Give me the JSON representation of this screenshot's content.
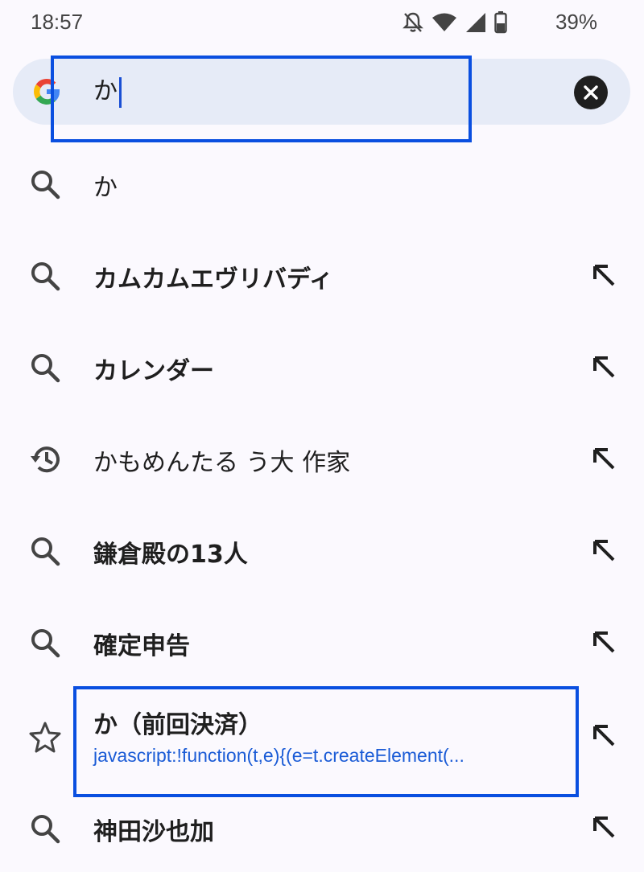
{
  "status_bar": {
    "time": "18:57",
    "battery_percent": "39%",
    "icons": [
      "bell-off-icon",
      "wifi-icon",
      "cell-signal-icon",
      "battery-icon"
    ]
  },
  "search": {
    "query": "か",
    "icons": [
      "google-logo-icon",
      "clear-icon"
    ]
  },
  "suggestions": [
    {
      "text": "か",
      "icon": "search-icon",
      "bold": false
    },
    {
      "text": "カムカムエヴリバディ",
      "icon": "search-icon",
      "bold": true
    },
    {
      "text": "カレンダー",
      "icon": "search-icon",
      "bold": true
    },
    {
      "text": "かもめんたる う大 作家",
      "icon": "history-icon",
      "bold": false
    },
    {
      "text": "鎌倉殿の13人",
      "icon": "search-icon",
      "bold": true
    },
    {
      "text": "確定申告",
      "icon": "search-icon",
      "bold": true
    },
    {
      "text": "か（前回決済）",
      "subtext": "javascript:!function(t,e){(e=t.createElement(...",
      "icon": "star-icon",
      "bold": true
    },
    {
      "text": "神田沙也加",
      "icon": "search-icon",
      "bold": true
    }
  ],
  "colors": {
    "background": "#fbf9fe",
    "search_bar": "#e6ebf7",
    "highlight": "#0a4fe0",
    "link": "#1a5bd6"
  }
}
